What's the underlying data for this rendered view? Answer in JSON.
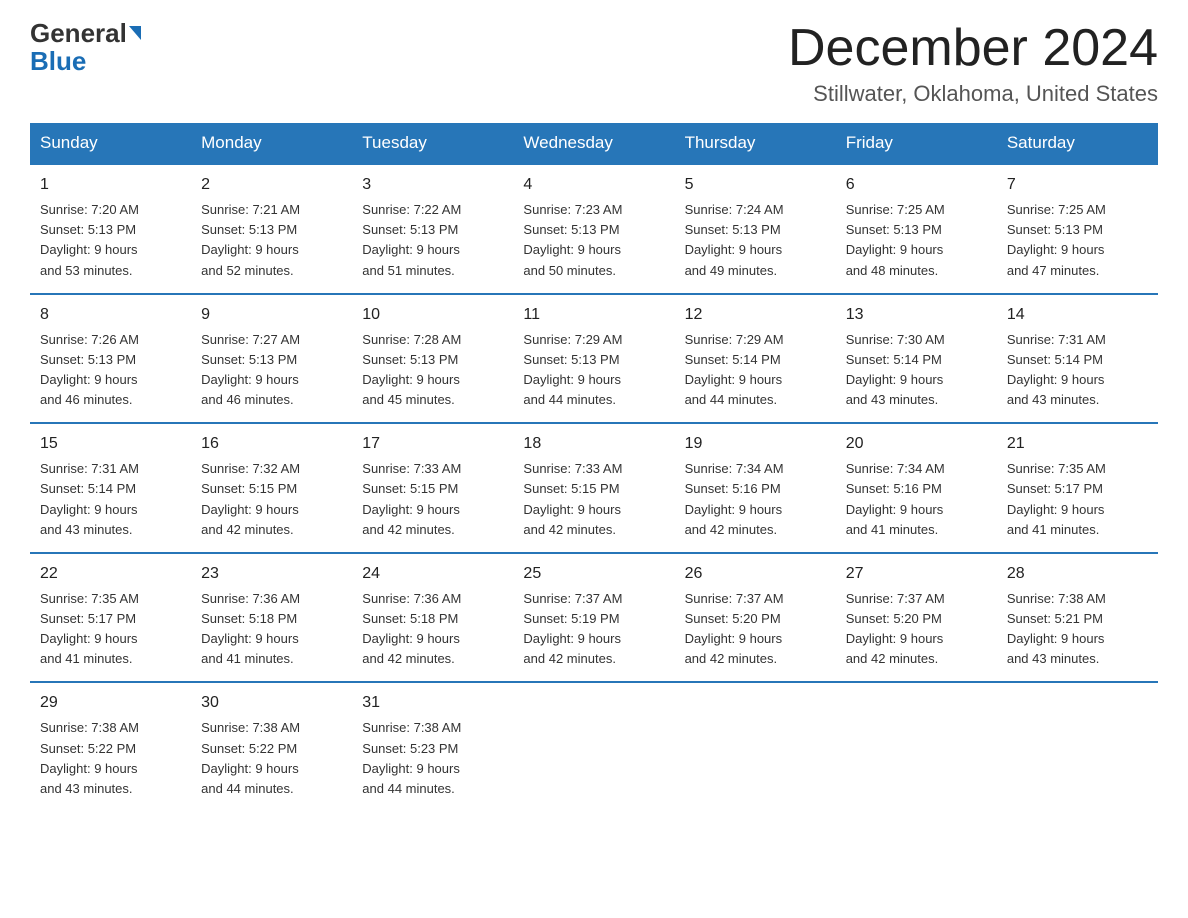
{
  "logo": {
    "general": "General",
    "blue": "Blue"
  },
  "header": {
    "title": "December 2024",
    "subtitle": "Stillwater, Oklahoma, United States"
  },
  "weekdays": [
    "Sunday",
    "Monday",
    "Tuesday",
    "Wednesday",
    "Thursday",
    "Friday",
    "Saturday"
  ],
  "weeks": [
    [
      {
        "day": "1",
        "sunrise": "7:20 AM",
        "sunset": "5:13 PM",
        "daylight": "9 hours and 53 minutes."
      },
      {
        "day": "2",
        "sunrise": "7:21 AM",
        "sunset": "5:13 PM",
        "daylight": "9 hours and 52 minutes."
      },
      {
        "day": "3",
        "sunrise": "7:22 AM",
        "sunset": "5:13 PM",
        "daylight": "9 hours and 51 minutes."
      },
      {
        "day": "4",
        "sunrise": "7:23 AM",
        "sunset": "5:13 PM",
        "daylight": "9 hours and 50 minutes."
      },
      {
        "day": "5",
        "sunrise": "7:24 AM",
        "sunset": "5:13 PM",
        "daylight": "9 hours and 49 minutes."
      },
      {
        "day": "6",
        "sunrise": "7:25 AM",
        "sunset": "5:13 PM",
        "daylight": "9 hours and 48 minutes."
      },
      {
        "day": "7",
        "sunrise": "7:25 AM",
        "sunset": "5:13 PM",
        "daylight": "9 hours and 47 minutes."
      }
    ],
    [
      {
        "day": "8",
        "sunrise": "7:26 AM",
        "sunset": "5:13 PM",
        "daylight": "9 hours and 46 minutes."
      },
      {
        "day": "9",
        "sunrise": "7:27 AM",
        "sunset": "5:13 PM",
        "daylight": "9 hours and 46 minutes."
      },
      {
        "day": "10",
        "sunrise": "7:28 AM",
        "sunset": "5:13 PM",
        "daylight": "9 hours and 45 minutes."
      },
      {
        "day": "11",
        "sunrise": "7:29 AM",
        "sunset": "5:13 PM",
        "daylight": "9 hours and 44 minutes."
      },
      {
        "day": "12",
        "sunrise": "7:29 AM",
        "sunset": "5:14 PM",
        "daylight": "9 hours and 44 minutes."
      },
      {
        "day": "13",
        "sunrise": "7:30 AM",
        "sunset": "5:14 PM",
        "daylight": "9 hours and 43 minutes."
      },
      {
        "day": "14",
        "sunrise": "7:31 AM",
        "sunset": "5:14 PM",
        "daylight": "9 hours and 43 minutes."
      }
    ],
    [
      {
        "day": "15",
        "sunrise": "7:31 AM",
        "sunset": "5:14 PM",
        "daylight": "9 hours and 43 minutes."
      },
      {
        "day": "16",
        "sunrise": "7:32 AM",
        "sunset": "5:15 PM",
        "daylight": "9 hours and 42 minutes."
      },
      {
        "day": "17",
        "sunrise": "7:33 AM",
        "sunset": "5:15 PM",
        "daylight": "9 hours and 42 minutes."
      },
      {
        "day": "18",
        "sunrise": "7:33 AM",
        "sunset": "5:15 PM",
        "daylight": "9 hours and 42 minutes."
      },
      {
        "day": "19",
        "sunrise": "7:34 AM",
        "sunset": "5:16 PM",
        "daylight": "9 hours and 42 minutes."
      },
      {
        "day": "20",
        "sunrise": "7:34 AM",
        "sunset": "5:16 PM",
        "daylight": "9 hours and 41 minutes."
      },
      {
        "day": "21",
        "sunrise": "7:35 AM",
        "sunset": "5:17 PM",
        "daylight": "9 hours and 41 minutes."
      }
    ],
    [
      {
        "day": "22",
        "sunrise": "7:35 AM",
        "sunset": "5:17 PM",
        "daylight": "9 hours and 41 minutes."
      },
      {
        "day": "23",
        "sunrise": "7:36 AM",
        "sunset": "5:18 PM",
        "daylight": "9 hours and 41 minutes."
      },
      {
        "day": "24",
        "sunrise": "7:36 AM",
        "sunset": "5:18 PM",
        "daylight": "9 hours and 42 minutes."
      },
      {
        "day": "25",
        "sunrise": "7:37 AM",
        "sunset": "5:19 PM",
        "daylight": "9 hours and 42 minutes."
      },
      {
        "day": "26",
        "sunrise": "7:37 AM",
        "sunset": "5:20 PM",
        "daylight": "9 hours and 42 minutes."
      },
      {
        "day": "27",
        "sunrise": "7:37 AM",
        "sunset": "5:20 PM",
        "daylight": "9 hours and 42 minutes."
      },
      {
        "day": "28",
        "sunrise": "7:38 AM",
        "sunset": "5:21 PM",
        "daylight": "9 hours and 43 minutes."
      }
    ],
    [
      {
        "day": "29",
        "sunrise": "7:38 AM",
        "sunset": "5:22 PM",
        "daylight": "9 hours and 43 minutes."
      },
      {
        "day": "30",
        "sunrise": "7:38 AM",
        "sunset": "5:22 PM",
        "daylight": "9 hours and 44 minutes."
      },
      {
        "day": "31",
        "sunrise": "7:38 AM",
        "sunset": "5:23 PM",
        "daylight": "9 hours and 44 minutes."
      },
      null,
      null,
      null,
      null
    ]
  ],
  "labels": {
    "sunrise": "Sunrise:",
    "sunset": "Sunset:",
    "daylight": "Daylight:"
  }
}
